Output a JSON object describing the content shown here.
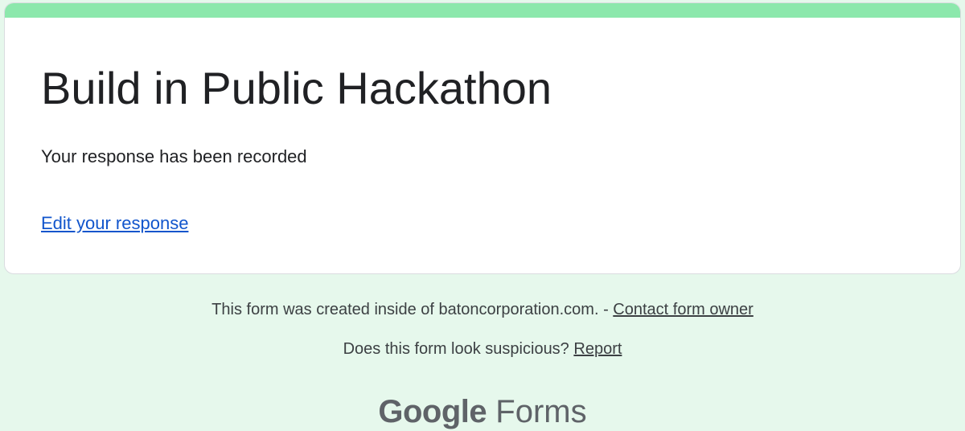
{
  "form": {
    "title": "Build in Public Hackathon",
    "confirmation_message": "Your response has been recorded",
    "edit_link_label": "Edit your response"
  },
  "footer": {
    "created_inside_text": "This form was created inside of batoncorporation.com. - ",
    "contact_owner_label": "Contact form owner",
    "suspicious_text": "Does this form look suspicious? ",
    "report_label": "Report"
  },
  "logo": {
    "google": "Google",
    "forms": "Forms"
  },
  "colors": {
    "background": "#e6f8ec",
    "accent": "#8ce8ac",
    "link": "#1155cc"
  }
}
